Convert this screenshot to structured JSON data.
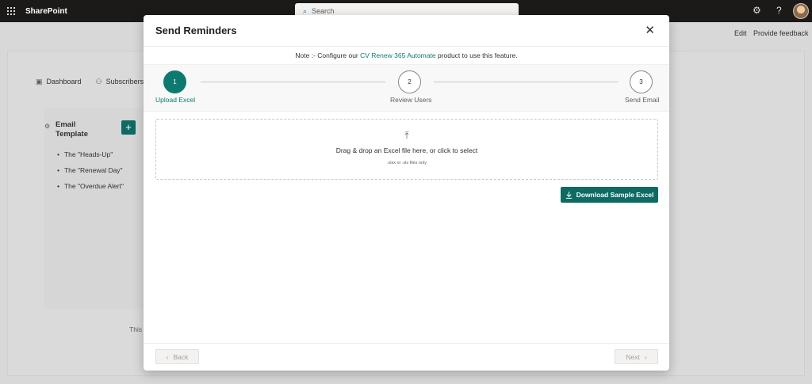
{
  "topbar": {
    "app_name": "SharePoint",
    "search_placeholder": "Search",
    "settings_icon": "⚙",
    "help_icon": "?"
  },
  "commands": {
    "edit": "Edit",
    "feedback": "Provide feedback"
  },
  "background": {
    "nav": [
      {
        "label": "Dashboard",
        "icon": "dashboard-icon"
      },
      {
        "label": "Subscribers",
        "icon": "subscribers-icon"
      }
    ],
    "card_title_line1": "Email",
    "card_title_line2": "Template",
    "add_label": "+",
    "templates": [
      "The \"Heads-Up\"",
      "The \"Renewal Day\"",
      "The \"Overdue Alert\""
    ],
    "fragment": "This"
  },
  "modal": {
    "title": "Send Reminders",
    "close_glyph": "✕",
    "note_prefix": "Note :- Configure our ",
    "note_link": "CV Renew 365 Automate",
    "note_suffix": " product to use this feature.",
    "steps": [
      {
        "number": "1",
        "label": "Upload Excel",
        "active": true
      },
      {
        "number": "2",
        "label": "Review Users",
        "active": false
      },
      {
        "number": "3",
        "label": "Send Email",
        "active": false
      }
    ],
    "dropzone": {
      "icon": "⤒",
      "text": "Drag & drop an Excel file here, or click to select",
      "hint": ".xlsx or .xls files only"
    },
    "download_label": "Download Sample Excel",
    "back_label": "Back",
    "next_label": "Next"
  },
  "colors": {
    "accent": "#0d7a70",
    "topbar": "#1b1a19"
  }
}
